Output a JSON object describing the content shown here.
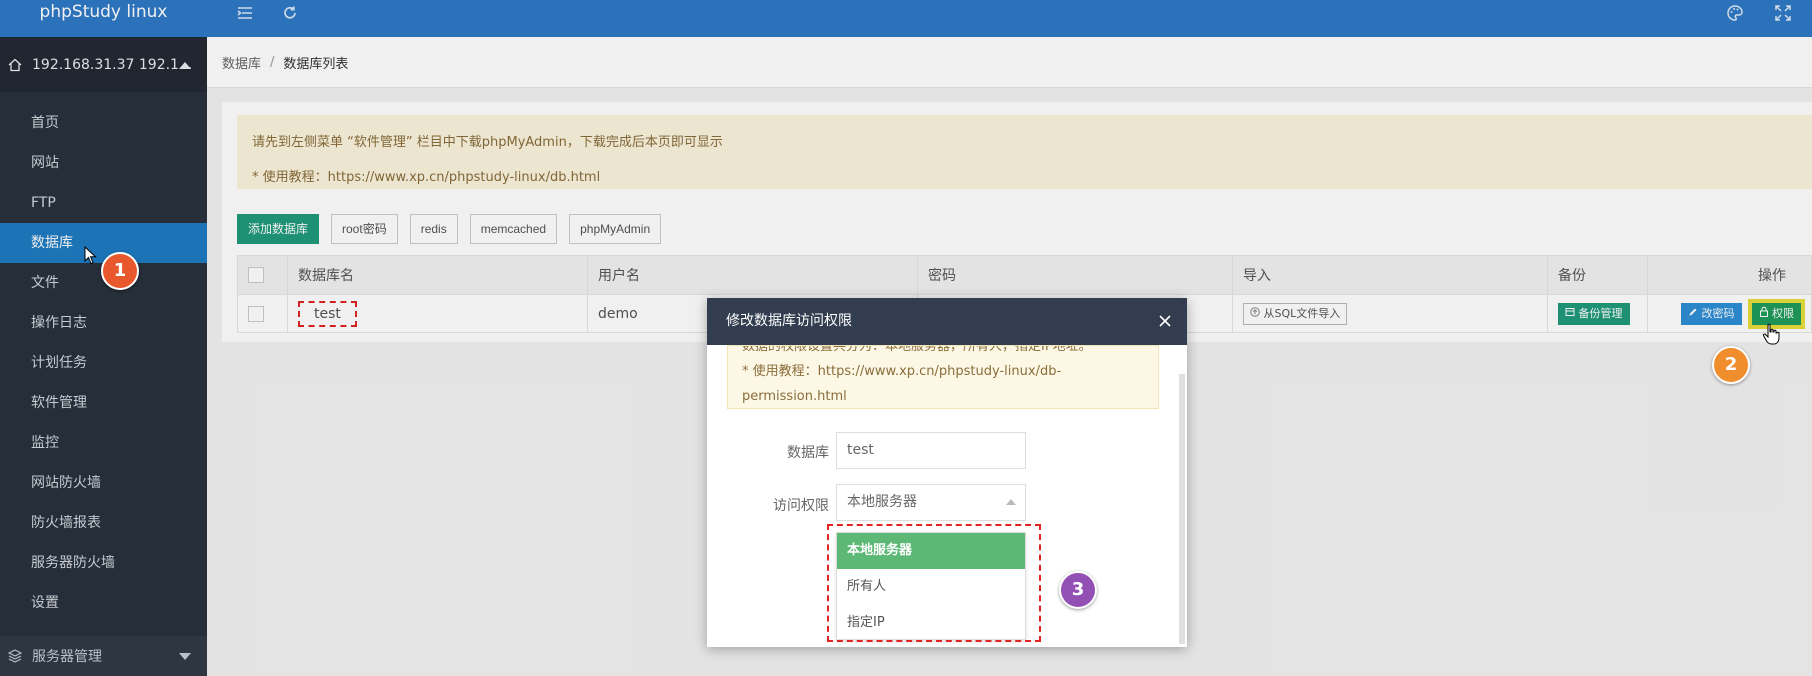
{
  "app": {
    "title": "phpStudy linux"
  },
  "server": {
    "label": "192.168.31.37 192.1..."
  },
  "nav": {
    "items": [
      "首页",
      "网站",
      "FTP",
      "数据库",
      "文件",
      "操作日志",
      "计划任务",
      "软件管理",
      "监控",
      "网站防火墙",
      "防火墙报表",
      "服务器防火墙",
      "设置"
    ],
    "active_index": 3,
    "server_manage": "服务器管理"
  },
  "breadcrumb": {
    "root": "数据库",
    "sep": "/",
    "current": "数据库列表"
  },
  "notice": {
    "line1": "请先到左侧菜单 “软件管理” 栏目中下载phpMyAdmin，下载完成后本页即可显示",
    "line2": "* 使用教程：https://www.xp.cn/phpstudy-linux/db.html"
  },
  "toolbar": {
    "add_db": "添加数据库",
    "root_pwd": "root密码",
    "redis": "redis",
    "memcached": "memcached",
    "phpmyadmin": "phpMyAdmin"
  },
  "table": {
    "headers": {
      "name": "数据库名",
      "user": "用户名",
      "password": "密码",
      "import": "导入",
      "backup": "备份",
      "ops": "操作"
    },
    "row": {
      "name": "test",
      "user": "demo",
      "import_btn": "从SQL文件导入",
      "backup_btn": "备份管理",
      "pwd_btn": "改密码",
      "perm_btn": "权限"
    }
  },
  "dialog": {
    "title": "修改数据库访问权限",
    "tip_line0": "数据的权限设置共分为：本地服务器，所有人，指定IP地址。",
    "tip_line1": "* 使用教程：https://www.xp.cn/phpstudy-linux/db-",
    "tip_line2": "permission.html",
    "db_label": "数据库",
    "db_value": "test",
    "perm_label": "访问权限",
    "perm_value": "本地服务器",
    "options": [
      "本地服务器",
      "所有人",
      "指定IP"
    ]
  },
  "steps": {
    "one": "1",
    "two": "2",
    "three": "3"
  },
  "colors": {
    "brand_blue": "#2f7ac6",
    "sidebar": "#28313d",
    "active_nav": "#1e7bc2",
    "teal": "#209a7c",
    "dialog_head": "#323d50",
    "selected_option": "#5cb874"
  },
  "icons": [
    "home-icon",
    "menu-toggle-icon",
    "refresh-icon",
    "palette-icon",
    "fullscreen-icon",
    "close-icon",
    "stack-icon",
    "lock-icon",
    "pencil-icon",
    "upload-icon",
    "database-icon"
  ]
}
